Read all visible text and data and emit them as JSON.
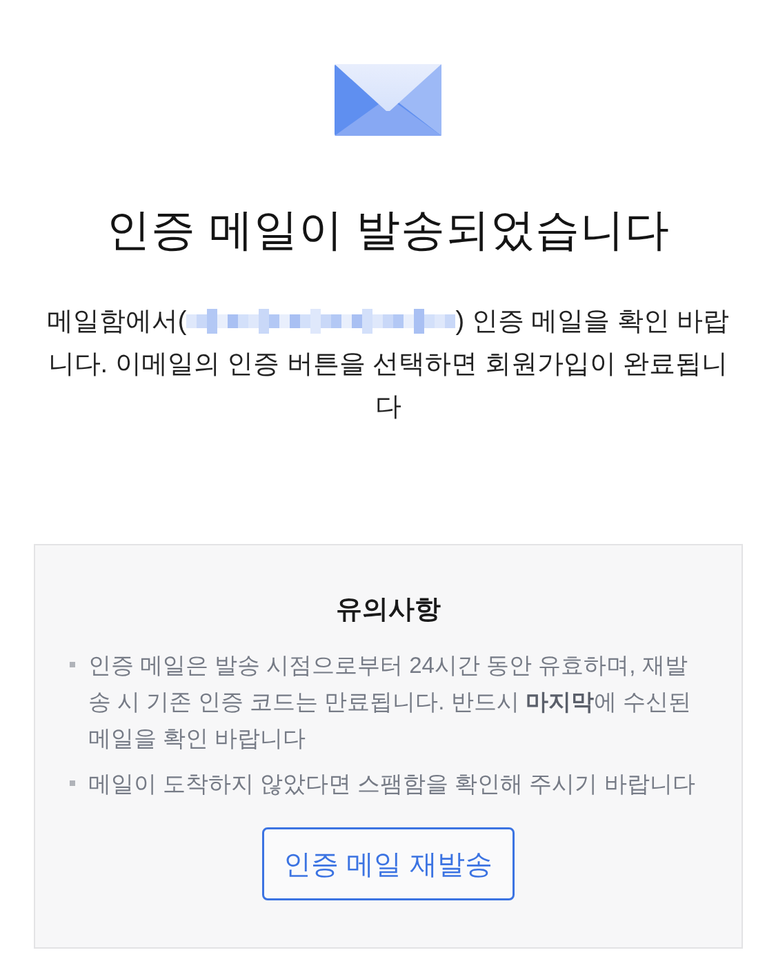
{
  "title": "인증 메일이 발송되었습니다",
  "message": {
    "before": "메일함에서(",
    "after": ") 인증 메일을 확인 바랍니다. 이메일의 인증 버튼을 선택하면 회원가입이 완료됩니다"
  },
  "notice": {
    "title": "유의사항",
    "items": [
      "인증 메일은 발송 시점으로부터 24시간 동안 유효하며, 재발송 시 기존 인증 코드는 만료됩니다. 반드시 **마지막**에 수신된 메일을 확인 바랍니다",
      "메일이 도착하지 않았다면 스팸함을 확인해 주시기 바랍니다"
    ],
    "button": "인증 메일 재발송"
  }
}
